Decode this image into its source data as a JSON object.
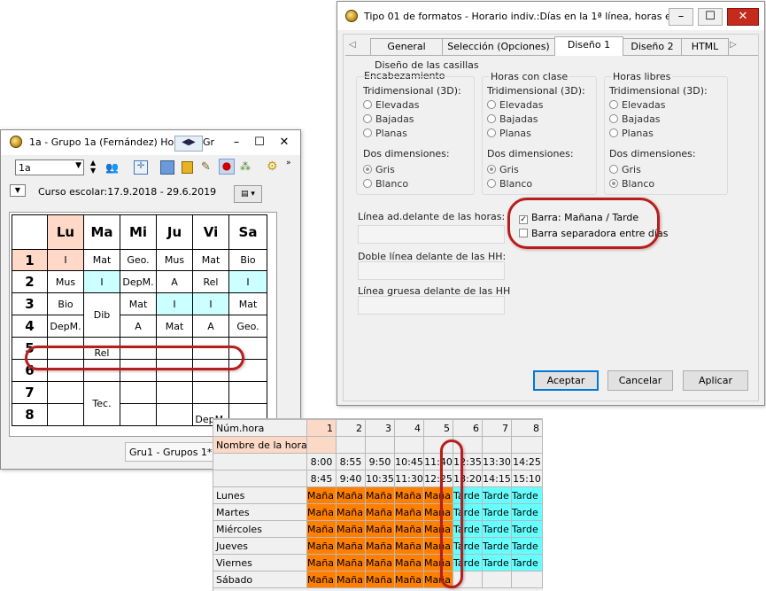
{
  "left_window": {
    "title": "1a - Grupo 1a (Fernández)  Hora",
    "title_tail": "Gr",
    "min_btn": "–",
    "max_btn": "☐",
    "close_btn": "✕",
    "class_select": "1a",
    "course_text": "Curso escolar:17.9.2018 - 29.6.2019",
    "status_text": "Gru1 - Grupos 1*",
    "days": [
      "Lu",
      "Ma",
      "Mi",
      "Ju",
      "Vi",
      "Sa"
    ],
    "hours": [
      "1",
      "2",
      "3",
      "4",
      "5",
      "6",
      "7",
      "8"
    ],
    "cells": {
      "r1": [
        "I",
        "Mat",
        "Geo.",
        "Mus",
        "Mat",
        "Bio"
      ],
      "r2": [
        "Mus",
        "I",
        "DepM.",
        "A",
        "Rel",
        "I"
      ],
      "r3": [
        "Bio",
        "Dib",
        "Mat",
        "I",
        "I",
        "Mat"
      ],
      "r4": [
        "DepM.",
        "A",
        "Mat",
        "A",
        "Geo."
      ],
      "r5": [
        "Rel"
      ],
      "r7": [
        "Tec."
      ],
      "r8": [
        "DepM."
      ]
    }
  },
  "dialog": {
    "title": "Tipo 01 de formatos - Horario indiv.:Días en la 1ª línea, horas e...",
    "min_btn": "–",
    "max_btn": "☐",
    "close_btn": "✕",
    "tabs": [
      "General",
      "Selección (Opciones)",
      "Diseño 1",
      "Diseño 2",
      "HTML"
    ],
    "active_tab": "Diseño 1",
    "section_title_1": "Diseño de las casillas",
    "section_title_2": "Encabezamiento",
    "groups": [
      {
        "title": "",
        "three_d": "Tridimensional (3D):",
        "opt_raised": "Elevadas",
        "opt_sunken": "Bajadas",
        "opt_flat": "Planas",
        "two_d": "Dos dimensiones:",
        "opt_gray": "Gris",
        "opt_white": "Blanco",
        "selected": "Gris"
      },
      {
        "title": "Horas con clase",
        "three_d": "Tridimensional (3D):",
        "opt_raised": "Elevadas",
        "opt_sunken": "Bajadas",
        "opt_flat": "Planas",
        "two_d": "Dos dimensiones:",
        "opt_gray": "Gris",
        "opt_white": "Blanco",
        "selected": "Gris"
      },
      {
        "title": "Horas libres",
        "three_d": "Tridimensional (3D):",
        "opt_raised": "Elevadas",
        "opt_sunken": "Bajadas",
        "opt_flat": "Planas",
        "two_d": "Dos dimensiones:",
        "opt_gray": "Gris",
        "opt_white": "Blanco",
        "selected": "Blanco"
      }
    ],
    "line_before_hours": "Línea ad.delante de las horas:",
    "double_line": "Doble línea delante de las HH:",
    "thick_line": "Línea gruesa delante de las HH",
    "check_bar": "Barra:  Mañana / Tarde",
    "check_bar_checked": true,
    "check_sep": "Barra separadora entre días",
    "check_sep_checked": false,
    "btn_accept": "Aceptar",
    "btn_cancel": "Cancelar",
    "btn_apply": "Aplicar"
  },
  "grid": {
    "header_label": "Núm.hora",
    "name_label": "Nombre de la hora",
    "numbers": [
      "1",
      "2",
      "3",
      "4",
      "5",
      "6",
      "7",
      "8"
    ],
    "start_times": [
      "8:00",
      "8:55",
      "9:50",
      "10:45",
      "11:40",
      "12:35",
      "13:30",
      "14:25"
    ],
    "end_times": [
      "8:45",
      "9:40",
      "10:35",
      "11:30",
      "12:25",
      "13:20",
      "14:15",
      "15:10"
    ],
    "days": [
      "Lunes",
      "Martes",
      "Miércoles",
      "Jueves",
      "Viernes",
      "Sábado"
    ],
    "morning": "Maña",
    "afternoon": "Tarde",
    "colors": {
      "morning": "#ff7f00",
      "afternoon": "#66ffff",
      "highlight": "#fbd9c6",
      "annotation": "#b41e1e"
    }
  }
}
